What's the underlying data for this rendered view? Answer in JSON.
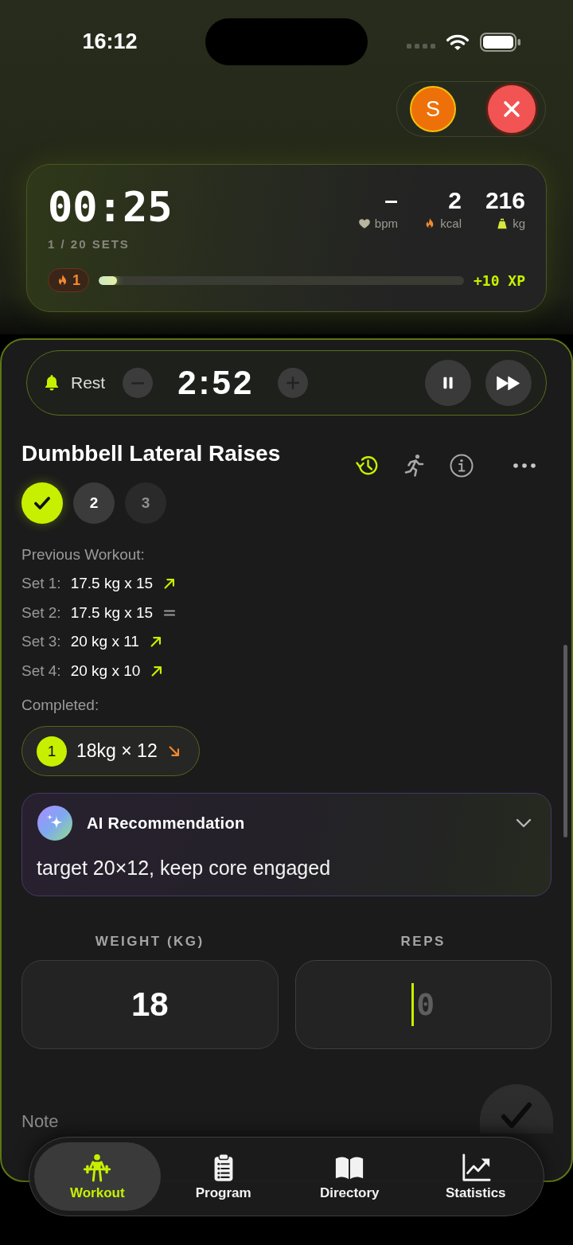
{
  "status_bar": {
    "time": "16:12"
  },
  "header": {
    "avatar_initial": "S"
  },
  "session": {
    "elapsed": "00:25",
    "sets_done": "1 / 20 SETS",
    "stats": [
      {
        "value": "–",
        "unit": "bpm"
      },
      {
        "value": "2",
        "unit": "kcal"
      },
      {
        "value": "216",
        "unit": "kg"
      }
    ],
    "streak": "1",
    "level": 0.05,
    "xp": "+10 XP"
  },
  "rest_timer": {
    "label": "Rest",
    "remaining": "2:52"
  },
  "exercise": {
    "title": "Dumbbell Lateral Raises",
    "actions": [
      {
        "selected": true
      },
      {
        "selected": false
      },
      {
        "selected": false
      },
      {
        "selected": false
      }
    ],
    "sets": [
      {
        "done": true,
        "selected": false
      },
      {
        "label": "2",
        "done": false,
        "selected": true
      },
      {
        "label": "3",
        "done": false,
        "selected": false
      }
    ]
  },
  "previous_workout": {
    "title": "Previous Workout:",
    "sets": [
      {
        "label": "Set 1:",
        "value": "17.5 kg x 15",
        "kind": "up"
      },
      {
        "label": "Set 2:",
        "value": "17.5 kg x 15",
        "kind": "equal"
      },
      {
        "label": "Set 3:",
        "value": "20 kg x 11",
        "kind": "up"
      },
      {
        "label": "Set 4:",
        "value": "20 kg x 10",
        "kind": "up"
      }
    ]
  },
  "completed": {
    "title": "Completed:",
    "sets": [
      {
        "number": "1",
        "value": "18kg × 12",
        "kind": "down"
      }
    ]
  },
  "ai_recommendation": {
    "title": "AI Recommendation",
    "text": "target 20×12, keep core engaged",
    "expanded": true
  },
  "inputs": [
    {
      "label": "WEIGHT (KG)",
      "value": "18",
      "focused": false
    },
    {
      "label": "REPS",
      "placeholder": "0",
      "focused": true
    }
  ],
  "note": {
    "label": "Note"
  },
  "tab_bar": [
    {
      "label": "Workout",
      "selected": true
    },
    {
      "label": "Program",
      "selected": false
    },
    {
      "label": "Directory",
      "selected": false
    },
    {
      "label": "Statistics",
      "selected": false
    }
  ]
}
